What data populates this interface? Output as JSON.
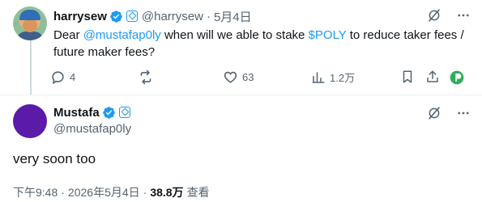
{
  "colors": {
    "accent": "#1d9bf0",
    "muted_text": "#536471",
    "primary_text": "#0f1419",
    "verified": "#1d9bf0",
    "divider": "#eff3f4"
  },
  "tweet": {
    "author_name": "harrysew",
    "author_handle": "@harrysew",
    "date": "5月4日",
    "separator": "·",
    "text_prefix": "Dear ",
    "mention": "@mustafap0ly",
    "text_middle": " when will we able to stake ",
    "cashtag": "$POLY",
    "text_suffix": " to reduce taker fees / future maker fees?",
    "replies": "4",
    "reposts": "",
    "likes": "63",
    "views": "1.2万",
    "icons": [
      "grok-icon",
      "more-icon",
      "reply-icon",
      "repost-icon",
      "like-icon",
      "views-icon",
      "bookmark-icon",
      "share-icon"
    ]
  },
  "reply": {
    "author_name": "Mustafa",
    "author_handle": "@mustafap0ly",
    "text": "very soon too",
    "time": "下午9:48",
    "separator": "·",
    "date": "2026年5月4日",
    "views_count": "38.8万",
    "views_label": "查看",
    "icons": [
      "grok-icon",
      "more-icon"
    ]
  }
}
